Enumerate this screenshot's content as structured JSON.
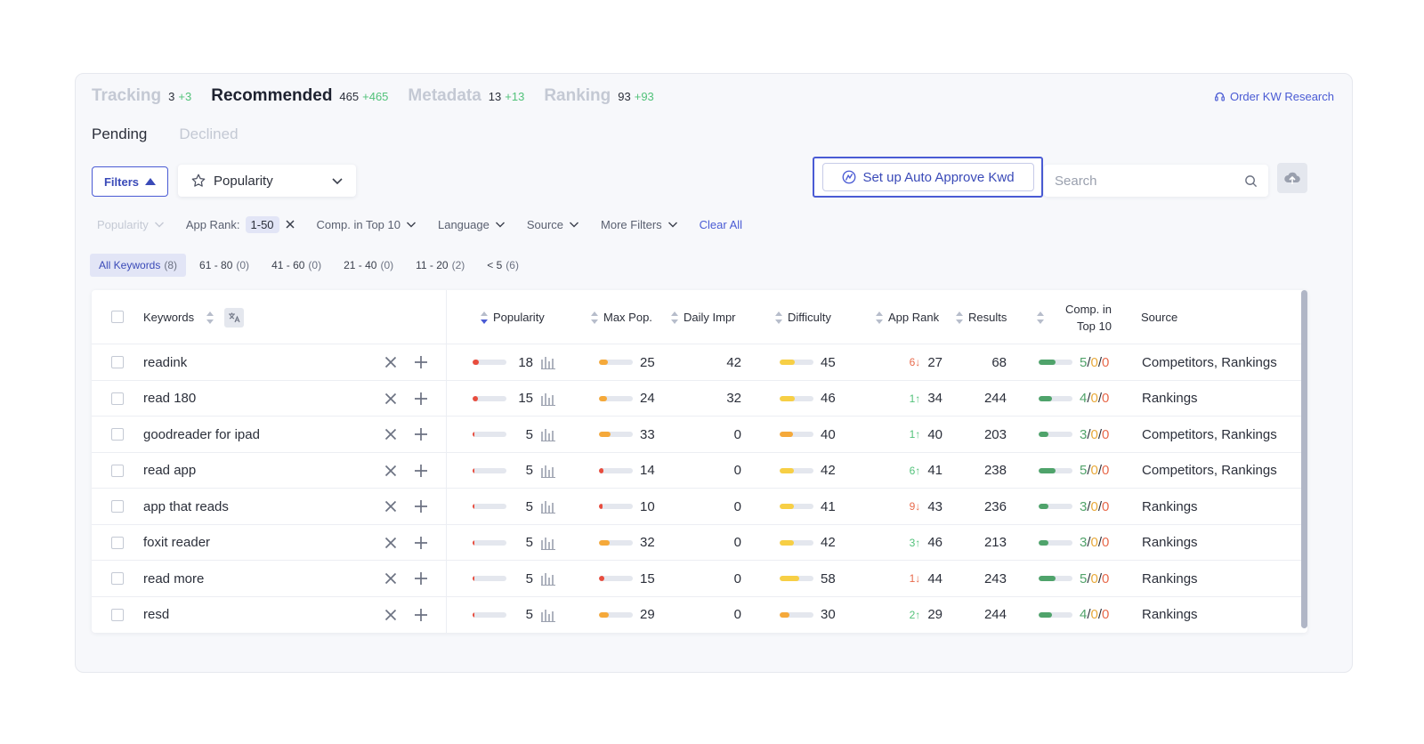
{
  "tabs": [
    {
      "label": "Tracking",
      "count": "3",
      "delta": "+3",
      "active": false
    },
    {
      "label": "Recommended",
      "count": "465",
      "delta": "+465",
      "active": true
    },
    {
      "label": "Metadata",
      "count": "13",
      "delta": "+13",
      "active": false
    },
    {
      "label": "Ranking",
      "count": "93",
      "delta": "+93",
      "active": false
    }
  ],
  "order_link": "Order KW Research",
  "subtabs": [
    {
      "label": "Pending",
      "active": true
    },
    {
      "label": "Declined",
      "active": false
    }
  ],
  "toolbar": {
    "filters_label": "Filters",
    "sort_select_value": "Popularity",
    "auto_approve_label": "Set up Auto Approve Kwd",
    "search_placeholder": "Search"
  },
  "filter_chips": {
    "popularity": "Popularity",
    "app_rank_label": "App Rank:",
    "app_rank_value": "1-50",
    "comp_top10": "Comp. in Top 10",
    "language": "Language",
    "source": "Source",
    "more_filters": "More Filters",
    "clear_all": "Clear All"
  },
  "range_tabs": [
    {
      "label": "All Keywords",
      "count": "(8)",
      "active": true
    },
    {
      "label": "61 - 80",
      "count": "(0)",
      "active": false
    },
    {
      "label": "41 - 60",
      "count": "(0)",
      "active": false
    },
    {
      "label": "21 - 40",
      "count": "(0)",
      "active": false
    },
    {
      "label": "11 - 20",
      "count": "(2)",
      "active": false
    },
    {
      "label": "< 5",
      "count": "(6)",
      "active": false
    }
  ],
  "table": {
    "headers": {
      "keywords": "Keywords",
      "popularity": "Popularity",
      "max_pop": "Max Pop.",
      "daily_impr": "Daily Impr",
      "difficulty": "Difficulty",
      "app_rank": "App Rank",
      "results": "Results",
      "comp_line1": "Comp. in",
      "comp_line2": "Top 10",
      "source": "Source"
    },
    "colors": {
      "red": "#e84c3d",
      "orange": "#f5a93a",
      "yellow": "#f7cf45",
      "green": "#4fa36b"
    },
    "rows": [
      {
        "keyword": "readink",
        "popularity": "18",
        "pop_color": "red",
        "pop_fill": 0.18,
        "max_pop": "25",
        "max_color": "orange",
        "max_fill": 0.25,
        "daily": "42",
        "difficulty": "45",
        "diff_color": "yellow",
        "diff_fill": 0.45,
        "rank_change": "6↓",
        "rank_dir": "down",
        "app_rank": "27",
        "results": "68",
        "comp_a": "5",
        "comp_b": "0",
        "comp_c": "0",
        "comp_fill": 0.5,
        "source": "Competitors, Rankings"
      },
      {
        "keyword": "read 180",
        "popularity": "15",
        "pop_color": "red",
        "pop_fill": 0.15,
        "max_pop": "24",
        "max_color": "orange",
        "max_fill": 0.24,
        "daily": "32",
        "difficulty": "46",
        "diff_color": "yellow",
        "diff_fill": 0.46,
        "rank_change": "1↑",
        "rank_dir": "up",
        "app_rank": "34",
        "results": "244",
        "comp_a": "4",
        "comp_b": "0",
        "comp_c": "0",
        "comp_fill": 0.4,
        "source": "Rankings"
      },
      {
        "keyword": "goodreader for ipad",
        "popularity": "5",
        "pop_color": "red",
        "pop_fill": 0.05,
        "max_pop": "33",
        "max_color": "orange",
        "max_fill": 0.33,
        "daily": "0",
        "difficulty": "40",
        "diff_color": "orange",
        "diff_fill": 0.4,
        "rank_change": "1↑",
        "rank_dir": "up",
        "app_rank": "40",
        "results": "203",
        "comp_a": "3",
        "comp_b": "0",
        "comp_c": "0",
        "comp_fill": 0.3,
        "source": "Competitors, Rankings"
      },
      {
        "keyword": "read app",
        "popularity": "5",
        "pop_color": "red",
        "pop_fill": 0.05,
        "max_pop": "14",
        "max_color": "red",
        "max_fill": 0.14,
        "daily": "0",
        "difficulty": "42",
        "diff_color": "yellow",
        "diff_fill": 0.42,
        "rank_change": "6↑",
        "rank_dir": "up",
        "app_rank": "41",
        "results": "238",
        "comp_a": "5",
        "comp_b": "0",
        "comp_c": "0",
        "comp_fill": 0.5,
        "source": "Competitors, Rankings"
      },
      {
        "keyword": "app that reads",
        "popularity": "5",
        "pop_color": "red",
        "pop_fill": 0.05,
        "max_pop": "10",
        "max_color": "red",
        "max_fill": 0.1,
        "daily": "0",
        "difficulty": "41",
        "diff_color": "yellow",
        "diff_fill": 0.41,
        "rank_change": "9↓",
        "rank_dir": "down",
        "app_rank": "43",
        "results": "236",
        "comp_a": "3",
        "comp_b": "0",
        "comp_c": "0",
        "comp_fill": 0.3,
        "source": "Rankings"
      },
      {
        "keyword": "foxit reader",
        "popularity": "5",
        "pop_color": "red",
        "pop_fill": 0.05,
        "max_pop": "32",
        "max_color": "orange",
        "max_fill": 0.32,
        "daily": "0",
        "difficulty": "42",
        "diff_color": "yellow",
        "diff_fill": 0.42,
        "rank_change": "3↑",
        "rank_dir": "up",
        "app_rank": "46",
        "results": "213",
        "comp_a": "3",
        "comp_b": "0",
        "comp_c": "0",
        "comp_fill": 0.3,
        "source": "Rankings"
      },
      {
        "keyword": "read more",
        "popularity": "5",
        "pop_color": "red",
        "pop_fill": 0.05,
        "max_pop": "15",
        "max_color": "red",
        "max_fill": 0.15,
        "daily": "0",
        "difficulty": "58",
        "diff_color": "yellow",
        "diff_fill": 0.58,
        "rank_change": "1↓",
        "rank_dir": "down",
        "app_rank": "44",
        "results": "243",
        "comp_a": "5",
        "comp_b": "0",
        "comp_c": "0",
        "comp_fill": 0.5,
        "source": "Rankings"
      },
      {
        "keyword": "resd",
        "popularity": "5",
        "pop_color": "red",
        "pop_fill": 0.05,
        "max_pop": "29",
        "max_color": "orange",
        "max_fill": 0.29,
        "daily": "0",
        "difficulty": "30",
        "diff_color": "orange",
        "diff_fill": 0.3,
        "rank_change": "2↑",
        "rank_dir": "up",
        "app_rank": "29",
        "results": "244",
        "comp_a": "4",
        "comp_b": "0",
        "comp_c": "0",
        "comp_fill": 0.4,
        "source": "Rankings"
      }
    ]
  }
}
